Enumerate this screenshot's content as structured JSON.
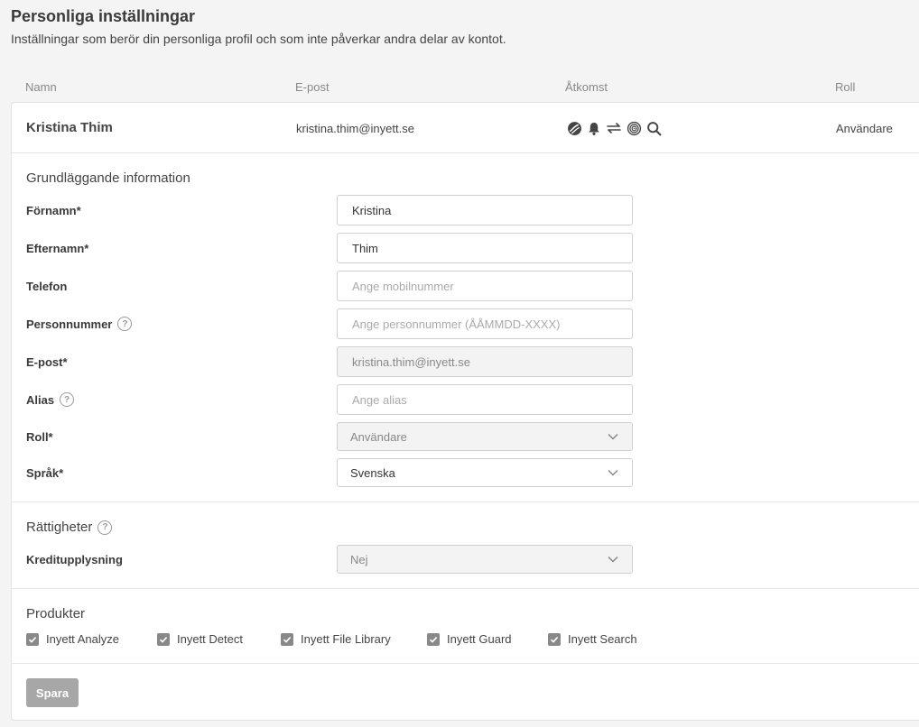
{
  "page": {
    "title": "Personliga inställningar",
    "subtitle": "Inställningar som berör din personliga profil och som inte påverkar andra delar av kontot."
  },
  "columns": {
    "name": "Namn",
    "email": "E-post",
    "access": "Åtkomst",
    "role": "Roll"
  },
  "user": {
    "name": "Kristina Thim",
    "email": "kristina.thim@inyett.se",
    "role": "Användare",
    "access_icons": [
      "analyze-icon",
      "bell-icon",
      "transfer-arrows-icon",
      "fingerprint-icon",
      "search-icon"
    ]
  },
  "basic_info": {
    "title": "Grundläggande information",
    "fields": {
      "first_name": {
        "label": "Förnamn*",
        "value": "Kristina",
        "placeholder": ""
      },
      "last_name": {
        "label": "Efternamn*",
        "value": "Thim",
        "placeholder": ""
      },
      "phone": {
        "label": "Telefon",
        "value": "",
        "placeholder": "Ange mobilnummer"
      },
      "personal_number": {
        "label": "Personnummer",
        "value": "",
        "placeholder": "Ange personnummer (ÅÅMMDD-XXXX)"
      },
      "email": {
        "label": "E-post*",
        "value": "kristina.thim@inyett.se",
        "placeholder": ""
      },
      "alias": {
        "label": "Alias",
        "value": "",
        "placeholder": "Ange alias"
      },
      "role": {
        "label": "Roll*",
        "value": "Användare"
      },
      "language": {
        "label": "Språk*",
        "value": "Svenska"
      }
    }
  },
  "rights": {
    "title": "Rättigheter",
    "credit_check": {
      "label": "Kreditupplysning",
      "value": "Nej"
    }
  },
  "products": {
    "title": "Produkter",
    "items": [
      {
        "label": "Inyett Analyze",
        "checked": true
      },
      {
        "label": "Inyett Detect",
        "checked": true
      },
      {
        "label": "Inyett File Library",
        "checked": true
      },
      {
        "label": "Inyett Guard",
        "checked": true
      },
      {
        "label": "Inyett Search",
        "checked": true
      }
    ]
  },
  "actions": {
    "save_label": "Spara"
  },
  "colors": {
    "icon": "#444444",
    "checkbox": "#888888",
    "button_disabled": "#a7a7a7"
  }
}
